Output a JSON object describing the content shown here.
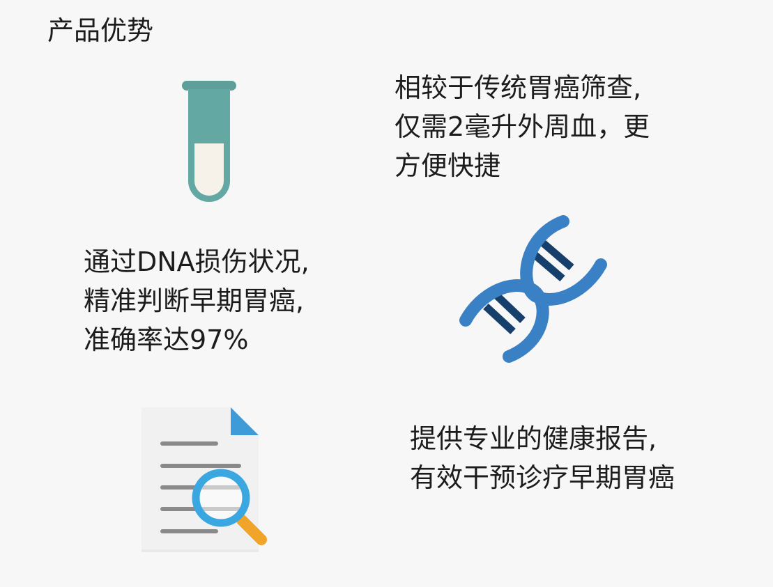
{
  "page": {
    "title": "产品优势"
  },
  "features": [
    {
      "icon": "test-tube-icon",
      "lines": [
        "相较于传统胃癌筛查,",
        "仅需2毫升外周血，更",
        "方便快捷"
      ]
    },
    {
      "icon": "dna-icon",
      "lines": [
        "通过DNA损伤状况,",
        "精准判断早期胃癌,",
        "准确率达97%"
      ]
    },
    {
      "icon": "report-search-icon",
      "lines": [
        "提供专业的健康报告,",
        "有效干预诊疗早期胃癌"
      ]
    }
  ],
  "colors": {
    "background": "#f8f7f8",
    "tube": "#63a8a2",
    "tube_fill": "#f6f1e9",
    "dna_strand": "#3a80c4",
    "dna_rung": "#163f6b",
    "doc_paper": "#eeeeee",
    "doc_corner": "#3f9bd8",
    "magnifier": "#3aa7e0",
    "magnifier_handle": "#f0a52a"
  }
}
